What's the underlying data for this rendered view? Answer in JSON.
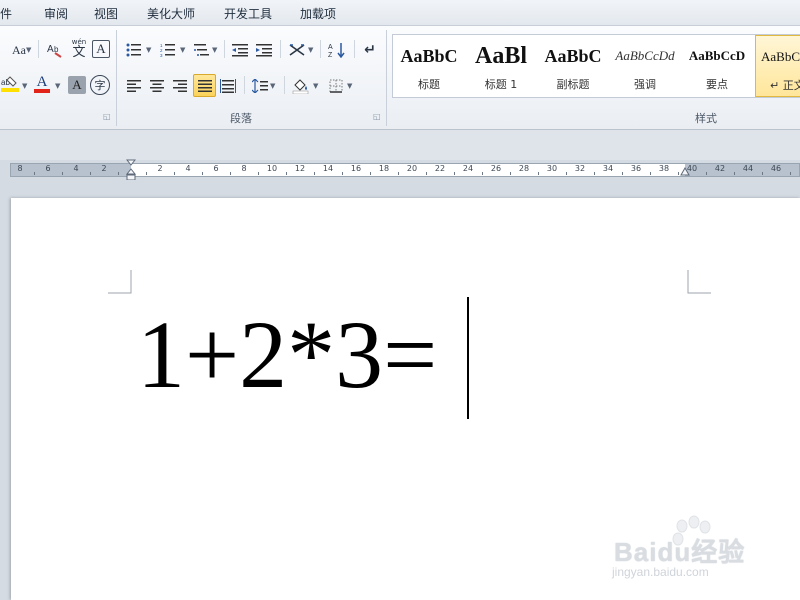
{
  "menu": {
    "tabs": [
      "件",
      "审阅",
      "视图",
      "美化大师",
      "开发工具",
      "加载项"
    ]
  },
  "ribbon": {
    "groups": {
      "paragraph_label": "段落",
      "styles_label": "样式"
    },
    "font_buttons": {
      "change_case": "Aa",
      "phonetic": "wén",
      "phonetic_char": "文",
      "char_border": "A",
      "font_color": "A",
      "char_shading": "A",
      "enclose_char": "字"
    },
    "styles": [
      {
        "sample": "AaBbC",
        "name": "标题"
      },
      {
        "sample": "AaBl",
        "name": "标题 1"
      },
      {
        "sample": "AaBbC",
        "name": "副标题"
      },
      {
        "sample": "AaBbCcDd",
        "name": "强调"
      },
      {
        "sample": "AaBbCcD",
        "name": "要点"
      },
      {
        "sample": "AaBbC",
        "name": "↵ 正文"
      }
    ]
  },
  "ruler": {
    "left_numbers": [
      "8",
      "6",
      "4",
      "2"
    ],
    "right_numbers": [
      "2",
      "4",
      "6",
      "8",
      "10",
      "12",
      "14",
      "16",
      "18",
      "20",
      "22",
      "24",
      "26",
      "28",
      "30",
      "32",
      "34",
      "36",
      "38",
      "40",
      "42",
      "44",
      "46"
    ]
  },
  "document": {
    "text": "1+2*3="
  },
  "watermark": {
    "brand": "Baidu经验",
    "url": "jingyan.baidu.com"
  },
  "colors": {
    "font_color_bar": "#e2231a",
    "highlight_bar": "#ffe000",
    "selected_style_bg": "#ffe69b"
  }
}
